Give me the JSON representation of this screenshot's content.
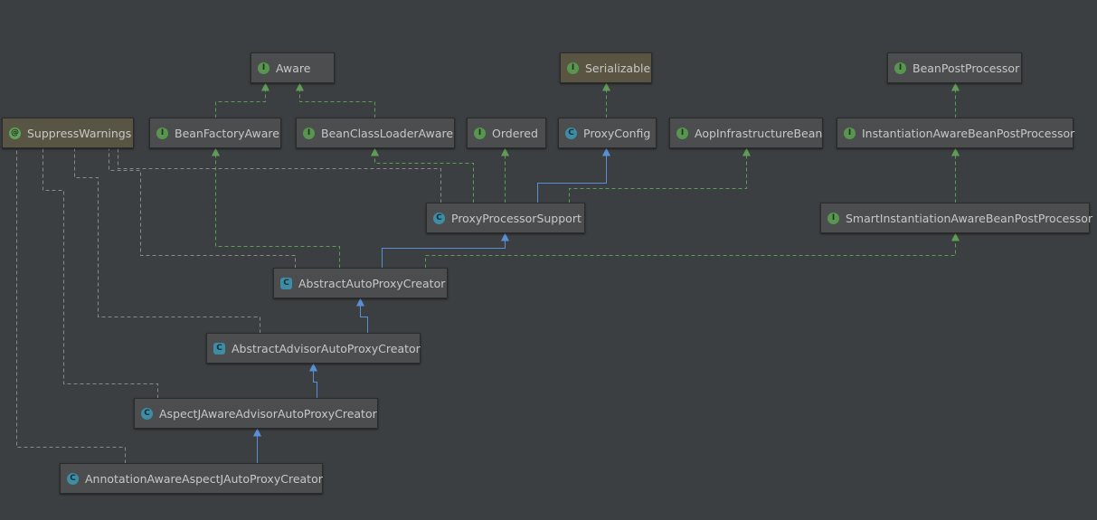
{
  "colors": {
    "background": "#3c3f41",
    "node": "#4b4d4f",
    "implements_edge": "#5f9c57",
    "extends_edge": "#5a8fd6",
    "dependency_edge": "#8a8a8a"
  },
  "nodes": [
    {
      "id": "aware",
      "label": "Aware",
      "kind": "interface",
      "icon": "I"
    },
    {
      "id": "serializable",
      "label": "Serializable",
      "kind": "interface",
      "icon": "I"
    },
    {
      "id": "beanpost",
      "label": "BeanPostProcessor",
      "kind": "interface",
      "icon": "I"
    },
    {
      "id": "suppress",
      "label": "SuppressWarnings",
      "kind": "annotation",
      "icon": "@"
    },
    {
      "id": "bfaware",
      "label": "BeanFactoryAware",
      "kind": "interface",
      "icon": "I"
    },
    {
      "id": "bclaware",
      "label": "BeanClassLoaderAware",
      "kind": "interface",
      "icon": "I"
    },
    {
      "id": "ordered",
      "label": "Ordered",
      "kind": "interface",
      "icon": "I"
    },
    {
      "id": "proxyconfig",
      "label": "ProxyConfig",
      "kind": "class",
      "icon": "C"
    },
    {
      "id": "aopinfra",
      "label": "AopInfrastructureBean",
      "kind": "interface",
      "icon": "I"
    },
    {
      "id": "instaware",
      "label": "InstantiationAwareBeanPostProcessor",
      "kind": "interface",
      "icon": "I"
    },
    {
      "id": "pps",
      "label": "ProxyProcessorSupport",
      "kind": "class",
      "icon": "C"
    },
    {
      "id": "smart",
      "label": "SmartInstantiationAwareBeanPostProcessor",
      "kind": "interface",
      "icon": "I"
    },
    {
      "id": "aapc",
      "label": "AbstractAutoProxyCreator",
      "kind": "abstract",
      "icon": "C"
    },
    {
      "id": "aaapc",
      "label": "AbstractAdvisorAutoProxyCreator",
      "kind": "abstract",
      "icon": "C"
    },
    {
      "id": "ajaapc",
      "label": "AspectJAwareAdvisorAutoProxyCreator",
      "kind": "class",
      "icon": "C"
    },
    {
      "id": "aaajapc",
      "label": "AnnotationAwareAspectJAutoProxyCreator",
      "kind": "class",
      "icon": "C"
    }
  ],
  "edges": [
    {
      "from": "bfaware",
      "to": "aware",
      "type": "implements"
    },
    {
      "from": "bclaware",
      "to": "aware",
      "type": "implements"
    },
    {
      "from": "proxyconfig",
      "to": "serializable",
      "type": "implements"
    },
    {
      "from": "instaware",
      "to": "beanpost",
      "type": "implements"
    },
    {
      "from": "smart",
      "to": "instaware",
      "type": "implements"
    },
    {
      "from": "pps",
      "to": "bclaware",
      "type": "implements"
    },
    {
      "from": "pps",
      "to": "ordered",
      "type": "implements"
    },
    {
      "from": "pps",
      "to": "proxyconfig",
      "type": "extends"
    },
    {
      "from": "pps",
      "to": "aopinfra",
      "type": "implements"
    },
    {
      "from": "aapc",
      "to": "pps",
      "type": "extends"
    },
    {
      "from": "aapc",
      "to": "bfaware",
      "type": "implements"
    },
    {
      "from": "aapc",
      "to": "smart",
      "type": "implements"
    },
    {
      "from": "aaapc",
      "to": "aapc",
      "type": "extends"
    },
    {
      "from": "ajaapc",
      "to": "aaapc",
      "type": "extends"
    },
    {
      "from": "aaajapc",
      "to": "ajaapc",
      "type": "extends"
    },
    {
      "from": "pps",
      "to": "suppress",
      "type": "dependency"
    },
    {
      "from": "aapc",
      "to": "suppress",
      "type": "dependency"
    },
    {
      "from": "aaapc",
      "to": "suppress",
      "type": "dependency"
    },
    {
      "from": "ajaapc",
      "to": "suppress",
      "type": "dependency"
    },
    {
      "from": "aaajapc",
      "to": "suppress",
      "type": "dependency"
    }
  ]
}
